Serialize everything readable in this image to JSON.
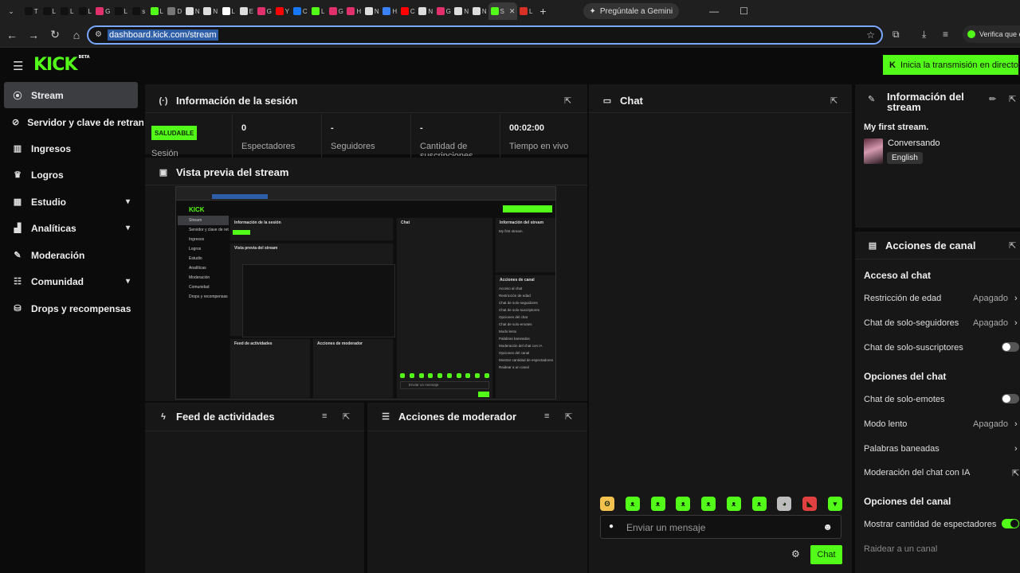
{
  "browser": {
    "tabs": [
      {
        "letter": "T",
        "color": "#111"
      },
      {
        "letter": "L",
        "color": "#111"
      },
      {
        "letter": "L",
        "color": "#111"
      },
      {
        "letter": "L",
        "color": "#111"
      },
      {
        "letter": "G",
        "color": "#e1306c"
      },
      {
        "letter": "L",
        "color": "#111"
      },
      {
        "letter": "s",
        "color": "#111"
      },
      {
        "letter": "L",
        "color": "#53fc18"
      },
      {
        "letter": "D",
        "color": "#777"
      },
      {
        "letter": "N",
        "color": "#ddd"
      },
      {
        "letter": "N",
        "color": "#ddd"
      },
      {
        "letter": "L",
        "color": "#fff"
      },
      {
        "letter": "E",
        "color": "#ddd"
      },
      {
        "letter": "G",
        "color": "#e1306c"
      },
      {
        "letter": "Y",
        "color": "#ff0000"
      },
      {
        "letter": "C",
        "color": "#1877f2"
      },
      {
        "letter": "L",
        "color": "#53fc18"
      },
      {
        "letter": "G",
        "color": "#e1306c"
      },
      {
        "letter": "H",
        "color": "#e1306c"
      },
      {
        "letter": "N",
        "color": "#ddd"
      },
      {
        "letter": "H",
        "color": "#3b82f6"
      },
      {
        "letter": "C",
        "color": "#ff0000"
      },
      {
        "letter": "N",
        "color": "#ddd"
      },
      {
        "letter": "G",
        "color": "#e1306c"
      },
      {
        "letter": "N",
        "color": "#ddd"
      },
      {
        "letter": "N",
        "color": "#ddd"
      }
    ],
    "active_tab": "S",
    "last_tab": "L",
    "gemini_label": "Pregúntale a Gemini",
    "url": "dashboard.kick.com/stream",
    "verify_label": "Verifica que e"
  },
  "topnav": {
    "logo": "KICK",
    "logo_badge": "BETA",
    "go_live": "Inicia la transmisión en directo"
  },
  "sidebar": {
    "items": [
      {
        "label": "Stream"
      },
      {
        "label": "Servidor y clave de retransmisión"
      },
      {
        "label": "Ingresos"
      },
      {
        "label": "Logros"
      },
      {
        "label": "Estudio"
      },
      {
        "label": "Analíticas"
      },
      {
        "label": "Moderación"
      },
      {
        "label": "Comunidad"
      },
      {
        "label": "Drops y recompensas"
      }
    ]
  },
  "session": {
    "title": "Información de la sesión",
    "badge": "SALUDABLE",
    "status_label": "Sesión",
    "stats": [
      {
        "value": "0",
        "label": "Espectadores"
      },
      {
        "value": "-",
        "label": "Seguidores"
      },
      {
        "value": "-",
        "label": "Cantidad de suscripciones"
      },
      {
        "value": "00:02:00",
        "label": "Tiempo en vivo"
      }
    ]
  },
  "preview": {
    "title": "Vista previa del stream",
    "mini_side": [
      "Stream",
      "Servidor y clave de retran",
      "Ingresos",
      "Logros",
      "Estudio",
      "Analíticas",
      "Moderación",
      "Comunidad",
      "Drops y recompensas"
    ],
    "mini_session": "Información de la sesión",
    "mini_preview": "Vista previa del stream",
    "mini_chat": "Chat",
    "mini_info": "Información del stream",
    "mini_first": "My first stream.",
    "mini_actions": "Acciones de canal",
    "mini_feed": "Feed de actividades",
    "mini_mod": "Acciones de moderador",
    "mini_send": "Enviar un mensaje",
    "mini_rows": [
      "Acceso al chat",
      "Restricción de edad",
      "Chat de solo-seguidores",
      "Chat de solo-suscriptores",
      "Opciones del chat",
      "Chat de solo-emotes",
      "Modo lento",
      "Palabras baneadas",
      "Moderación del chat con IA",
      "Opciones del canal",
      "Mostrar cantidad de espectadores",
      "Raidear a un canal"
    ]
  },
  "feed": {
    "title": "Feed de actividades"
  },
  "modactions": {
    "title": "Acciones de moderador"
  },
  "chat": {
    "title": "Chat",
    "placeholder": "Enviar un mensaje",
    "send": "Chat",
    "emotes": [
      "face",
      "frog",
      "frog",
      "frog",
      "frog",
      "frog",
      "frog",
      "alien",
      "angry",
      "cup"
    ]
  },
  "stream_info": {
    "title": "Información del stream",
    "stream_title": "My first stream.",
    "category": "Conversando",
    "language": "English"
  },
  "channel_actions": {
    "title": "Acciones de canal",
    "chat_access": "Acceso al chat",
    "age_restriction": {
      "label": "Restricción de edad",
      "value": "Apagado"
    },
    "followers_only": {
      "label": "Chat de solo-seguidores",
      "value": "Apagado"
    },
    "subs_only": {
      "label": "Chat de solo-suscriptores",
      "enabled": false
    },
    "chat_options": "Opciones del chat",
    "emotes_only": {
      "label": "Chat de solo-emotes",
      "enabled": false
    },
    "slow_mode": {
      "label": "Modo lento",
      "value": "Apagado"
    },
    "banned_words": {
      "label": "Palabras baneadas"
    },
    "ai_moderation": {
      "label": "Moderación del chat con IA"
    },
    "channel_options": "Opciones del canal",
    "show_viewers": {
      "label": "Mostrar cantidad de espectadores",
      "enabled": true
    },
    "raid": {
      "label": "Raidear a un canal"
    }
  },
  "colors": {
    "accent": "#53fc18",
    "panel": "#171717",
    "bg": "#0b0b0c"
  }
}
